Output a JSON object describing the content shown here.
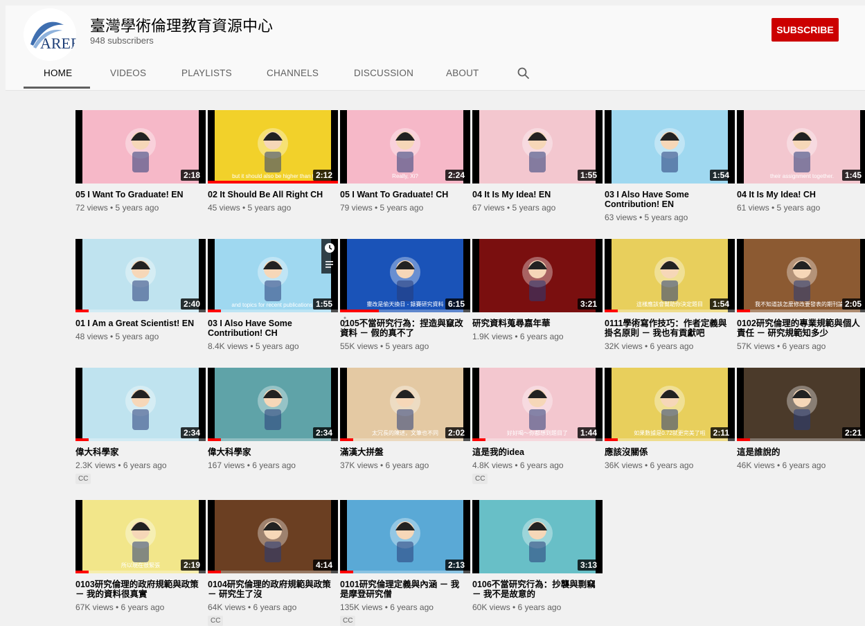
{
  "channel": {
    "name": "臺灣學術倫理教育資源中心",
    "subscribers": "948 subscribers",
    "logo_text": "AREE"
  },
  "subscribe_label": "SUBSCRIBE",
  "tabs": [
    {
      "label": "HOME",
      "active": true
    },
    {
      "label": "VIDEOS"
    },
    {
      "label": "PLAYLISTS"
    },
    {
      "label": "CHANNELS"
    },
    {
      "label": "DISCUSSION"
    },
    {
      "label": "ABOUT"
    }
  ],
  "colors": {
    "accent": "#cc0000",
    "progress": "#ff0000"
  },
  "videos": [
    {
      "title": "05 I Want To Graduate! EN",
      "meta": "72 views • 5 years ago",
      "duration": "2:18",
      "bg": "#f6b8c8",
      "progress": 0
    },
    {
      "title": "02 It Should Be All Right CH",
      "meta": "45 views • 5 years ago",
      "duration": "2:12",
      "bg": "#f2d12a",
      "progress": 1.0,
      "caption": "but it should also be higher than t"
    },
    {
      "title": "05 I Want To Graduate! CH",
      "meta": "79 views • 5 years ago",
      "duration": "2:24",
      "bg": "#f6b8c8",
      "progress": 0,
      "caption": "Really, Xi?"
    },
    {
      "title": "04 It Is My Idea! EN",
      "meta": "67 views • 5 years ago",
      "duration": "1:55",
      "bg": "#f3c7cf",
      "progress": 0
    },
    {
      "title": "03 I Also Have Some Contribution! EN",
      "meta": "63 views • 5 years ago",
      "duration": "1:54",
      "bg": "#9fd8f0",
      "progress": 0
    },
    {
      "title": "04 It Is My Idea! CH",
      "meta": "61 views • 5 years ago",
      "duration": "1:45",
      "bg": "#f3c7cf",
      "progress": 0,
      "caption": "their assignment together."
    },
    {
      "title": "01 I Am a Great Scientist! EN",
      "meta": "48 views • 5 years ago",
      "duration": "2:40",
      "bg": "#bfe3ef",
      "progress": 0.1
    },
    {
      "title": "03 I Also Have Some Contribution! CH",
      "meta": "8.4K views • 5 years ago",
      "duration": "1:55",
      "bg": "#9fd8f0",
      "progress": 0.1,
      "caption": "and topics for recent publications."
    },
    {
      "title": "0105不當研究行為：捏造與竄改資料 － 假的真不了",
      "meta": "55K views • 5 years ago",
      "duration": "6:15",
      "bg": "#1a53b8",
      "progress": 0.3,
      "caption": "靈改是偷天換日 - 錄賽研究資料"
    },
    {
      "title": "研究資料蒐尋嘉年華",
      "meta": "1.9K views • 6 years ago",
      "duration": "3:21",
      "bg": "#7a0f0f",
      "progress": 0
    },
    {
      "title": "0111學術寫作技巧：作者定義與掛名原則 － 我也有貢獻吧",
      "meta": "32K views • 6 years ago",
      "duration": "1:54",
      "bg": "#e8cf5c",
      "progress": 0.1,
      "caption": "這樣應該會幫助你決定題目"
    },
    {
      "title": "0102研究倫理的專業規範與個人責任 － 研究規範知多少",
      "meta": "57K views • 6 years ago",
      "duration": "2:05",
      "bg": "#8c5a32",
      "progress": 0.1,
      "caption": "我不知道該怎麼修改要發表的期刊論文"
    },
    {
      "title": "偉大科學家",
      "meta": "2.3K views • 6 years ago",
      "duration": "2:34",
      "bg": "#bfe3ef",
      "progress": 0.1,
      "cc": "CC"
    },
    {
      "title": "偉大科學家",
      "meta": "167 views • 6 years ago",
      "duration": "2:34",
      "bg": "#5fa3a8",
      "progress": 0.1
    },
    {
      "title": "滿漢大拼盤",
      "meta": "37K views • 6 years ago",
      "duration": "2:02",
      "bg": "#e4c9a3",
      "progress": 0.1,
      "caption": "太冗長的陳述，文筆也不同"
    },
    {
      "title": "這是我的idea",
      "meta": "4.8K views • 6 years ago",
      "duration": "1:44",
      "bg": "#f3c7cf",
      "progress": 0.1,
      "caption": "好好喝～你都想到題目了",
      "cc": "CC"
    },
    {
      "title": "應該沒關係",
      "meta": "36K views • 6 years ago",
      "duration": "2:11",
      "bg": "#e8cf5c",
      "progress": 0.1,
      "caption": "如果數據是0.72就更完美了啦"
    },
    {
      "title": "這是誰說的",
      "meta": "46K views • 6 years ago",
      "duration": "2:21",
      "bg": "#4b3a2a",
      "progress": 0.1
    },
    {
      "title": "0103研究倫理的政府規範與政策 － 我的資料很真實",
      "meta": "67K views • 6 years ago",
      "duration": "2:19",
      "bg": "#f2e68a",
      "progress": 0.1,
      "caption": "所以現在很緊張"
    },
    {
      "title": "0104研究倫理的政府規範與政策 － 研究生了沒",
      "meta": "64K views • 6 years ago",
      "duration": "4:14",
      "bg": "#6b3f22",
      "progress": 0.1,
      "cc": "CC"
    },
    {
      "title": "0101研究倫理定義與內涵 － 我是摩登研究僧",
      "meta": "135K views • 6 years ago",
      "duration": "2:13",
      "bg": "#5aa9d6",
      "progress": 0.1,
      "cc": "CC"
    },
    {
      "title": "0106不當研究行為：抄襲與剽竊 － 我不是故意的",
      "meta": "60K views • 6 years ago",
      "duration": "3:13",
      "bg": "#68bfc7",
      "progress": 0
    }
  ]
}
